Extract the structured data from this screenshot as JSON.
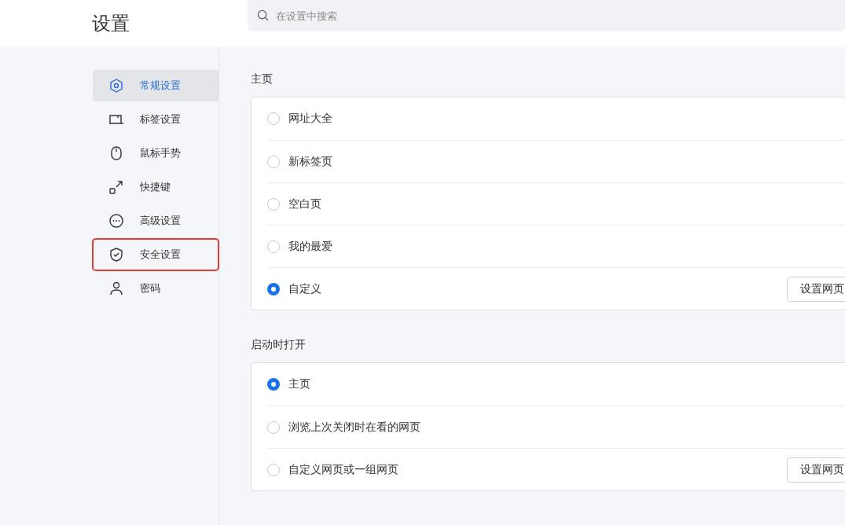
{
  "header": {
    "title": "设置",
    "search": {
      "placeholder": "在设置中搜索"
    }
  },
  "sidebar": {
    "items": [
      {
        "label": "常规设置",
        "kind": "hexagon",
        "selected": true,
        "highlighted": false
      },
      {
        "label": "标签设置",
        "kind": "tab",
        "selected": false,
        "highlighted": false
      },
      {
        "label": "鼠标手势",
        "kind": "mouse",
        "selected": false,
        "highlighted": false
      },
      {
        "label": "快捷键",
        "kind": "shortcut",
        "selected": false,
        "highlighted": false
      },
      {
        "label": "高级设置",
        "kind": "more",
        "selected": false,
        "highlighted": false
      },
      {
        "label": "安全设置",
        "kind": "shield",
        "selected": false,
        "highlighted": true
      },
      {
        "label": "密码",
        "kind": "user",
        "selected": false,
        "highlighted": false
      }
    ]
  },
  "sections": [
    {
      "title": "主页",
      "options": [
        {
          "label": "网址大全",
          "selected": false
        },
        {
          "label": "新标签页",
          "selected": false
        },
        {
          "label": "空白页",
          "selected": false
        },
        {
          "label": "我的最爱",
          "selected": false
        },
        {
          "label": "自定义",
          "selected": true,
          "button": "设置网页"
        }
      ]
    },
    {
      "title": "启动时打开",
      "options": [
        {
          "label": "主页",
          "selected": true
        },
        {
          "label": "浏览上次关闭时在看的网页",
          "selected": false
        },
        {
          "label": "自定义网页或一组网页",
          "selected": false,
          "button": "设置网页"
        }
      ]
    }
  ]
}
